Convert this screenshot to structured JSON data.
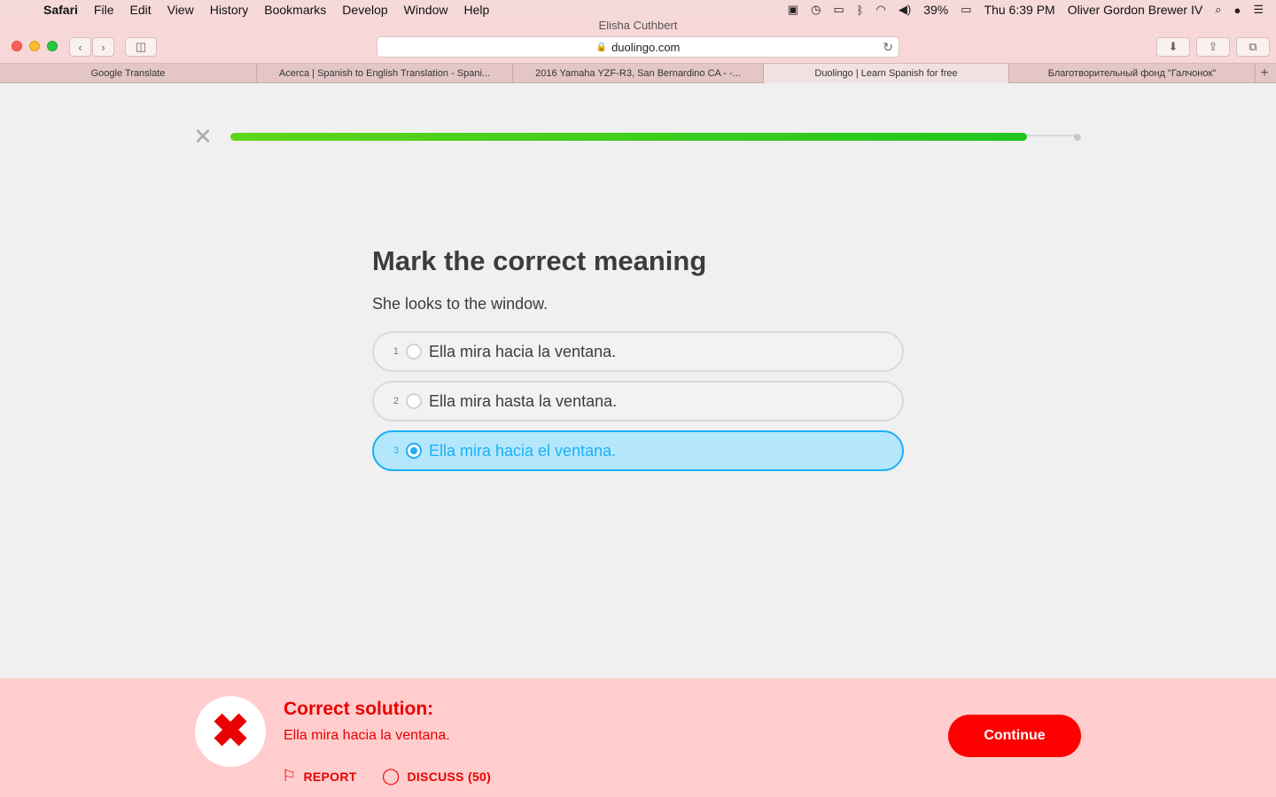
{
  "menubar": {
    "app": "Safari",
    "items": [
      "File",
      "Edit",
      "View",
      "History",
      "Bookmarks",
      "Develop",
      "Window",
      "Help"
    ],
    "battery": "39%",
    "clock": "Thu 6:39 PM",
    "user": "Oliver Gordon Brewer IV"
  },
  "browser": {
    "window_title": "Elisha Cuthbert",
    "url": "duolingo.com",
    "tabs": [
      {
        "label": "Google Translate",
        "active": false
      },
      {
        "label": "Acerca | Spanish to English Translation - Spani...",
        "active": false
      },
      {
        "label": "2016 Yamaha YZF-R3, San Bernardino CA - -...",
        "active": false
      },
      {
        "label": "Duolingo | Learn Spanish for free",
        "active": true
      },
      {
        "label": "Благотворительный фонд \"Галчонок\"",
        "active": false
      }
    ]
  },
  "lesson": {
    "progress": 0.94,
    "title": "Mark the correct meaning",
    "prompt": "She looks to the window.",
    "options": [
      {
        "num": "1",
        "text": "Ella mira hacia la ventana.",
        "selected": false
      },
      {
        "num": "2",
        "text": "Ella mira hasta la ventana.",
        "selected": false
      },
      {
        "num": "3",
        "text": "Ella mira hacia el ventana.",
        "selected": true
      }
    ]
  },
  "feedback": {
    "status": "incorrect",
    "title": "Correct solution:",
    "solution": "Ella mira hacia la ventana.",
    "report_label": "REPORT",
    "discuss_label": "DISCUSS (50)",
    "continue_label": "Continue"
  },
  "colors": {
    "progress": "#3ccc1c",
    "selected": "#1cb0f6",
    "error": "#ea0000",
    "footer_bg": "#ffcdcd"
  }
}
